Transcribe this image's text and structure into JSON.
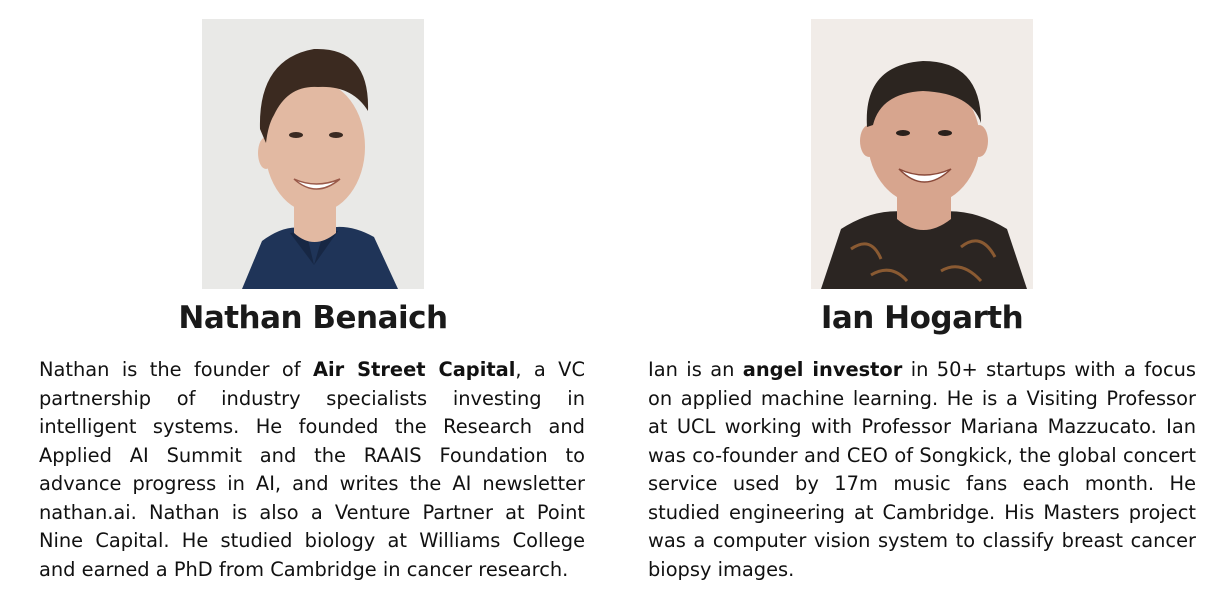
{
  "profiles": [
    {
      "name": "Nathan Benaich",
      "bio": {
        "before": "Nathan is the founder of ",
        "highlight": "Air Street Capital",
        "after": ", a VC partnership of industry specialists investing in intelligent systems. He founded the Research and Applied AI Summit and the RAAIS Foundation to advance progress in AI, and writes the AI newsletter nathan.ai. Nathan is also a Venture Partner at Point Nine Capital. He studied biology at Williams College and earned a PhD from Cambridge in cancer research."
      },
      "photo_colors": {
        "background": "#e9e9e7",
        "skin": "#e2b9a2",
        "hair": "#3b2a20",
        "shirt": "#1f3458"
      }
    },
    {
      "name": "Ian Hogarth",
      "bio": {
        "before": "Ian is an ",
        "highlight": "angel investor",
        "after": " in 50+ startups with a focus on applied machine learning. He is a Visiting Professor at UCL working with Professor Mariana Mazzucato. Ian was co-founder and CEO of Songkick, the global concert service used by 17m music fans each month. He studied engineering at Cambridge. His Masters project was a computer vision system to classify breast cancer biopsy images."
      },
      "photo_colors": {
        "background": "#f1ece8",
        "skin": "#d7a58e",
        "hair": "#2c2520",
        "shirt": "#2b2522"
      }
    }
  ]
}
